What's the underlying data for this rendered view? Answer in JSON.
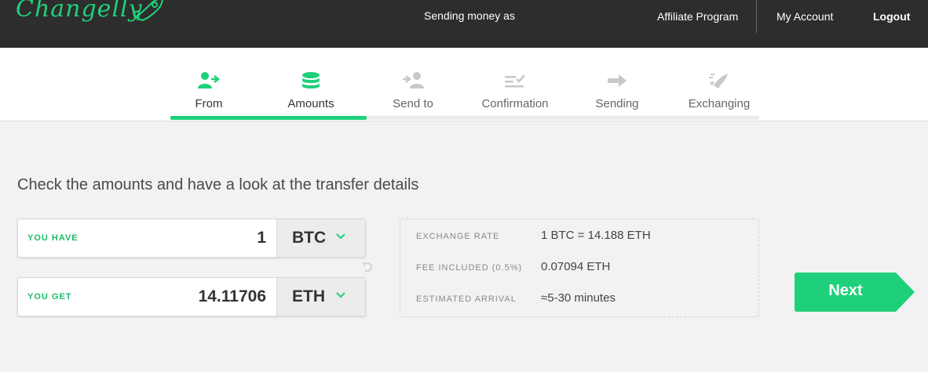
{
  "header": {
    "logo_text": "Changelly",
    "sending_as": "Sending money as",
    "nav": {
      "affiliate": "Affiliate Program",
      "account": "My Account",
      "logout": "Logout"
    }
  },
  "steps": [
    {
      "label": "From",
      "icon": "user-send-icon",
      "state": "done"
    },
    {
      "label": "Amounts",
      "icon": "coins-stack-icon",
      "state": "active"
    },
    {
      "label": "Send to",
      "icon": "send-to-user-icon",
      "state": "pending"
    },
    {
      "label": "Confirmation",
      "icon": "checklist-icon",
      "state": "pending"
    },
    {
      "label": "Sending",
      "icon": "arrow-right-icon",
      "state": "pending"
    },
    {
      "label": "Exchanging",
      "icon": "rocket-icon",
      "state": "pending"
    }
  ],
  "progress": {
    "completed_steps": 2,
    "total_steps": 6
  },
  "main": {
    "heading": "Check the amounts and have a look at the transfer details",
    "you_have": {
      "label": "YOU HAVE",
      "value": "1",
      "currency": "BTC"
    },
    "you_get": {
      "label": "YOU GET",
      "value": "14.11706",
      "currency": "ETH"
    },
    "details": {
      "exchange_rate_label": "EXCHANGE RATE",
      "exchange_rate_value": "1 BTC = 14.188 ETH",
      "fee_label": "FEE INCLUDED (0.5%)",
      "fee_value": "0.07094 ETH",
      "arrival_label": "ESTIMATED ARRIVAL",
      "arrival_value": "≈5-30 minutes"
    },
    "next_label": "Next"
  },
  "colors": {
    "accent": "#1fd07a",
    "header_bg": "#2d2d2d",
    "inactive_icon": "#c8c8c8"
  }
}
